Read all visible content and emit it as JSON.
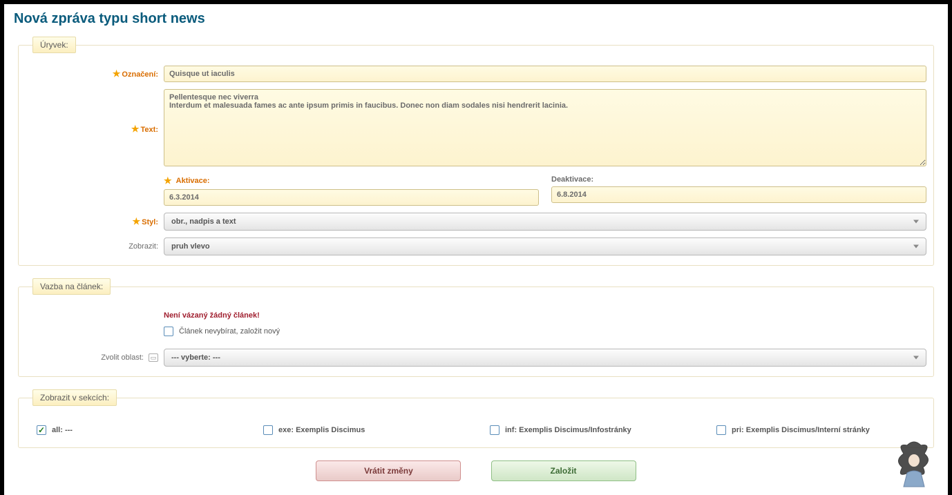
{
  "page": {
    "title": "Nová zpráva typu short news"
  },
  "fieldset1": {
    "legend": "Úryvek:"
  },
  "fieldset2": {
    "legend": "Vazba na článek:"
  },
  "fieldset3": {
    "legend": "Zobrazit v sekcích:"
  },
  "labels": {
    "oznaceni": "Označení:",
    "text": "Text:",
    "aktivace": "Aktivace:",
    "deaktivace": "Deaktivace:",
    "styl": "Styl:",
    "zobrazit": "Zobrazit:",
    "zvolit_oblast": "Zvolit oblast:"
  },
  "values": {
    "oznaceni": "Quisque ut iaculis",
    "text": "Pellentesque nec viverra\nInterdum et malesuada fames ac ante ipsum primis in faucibus. Donec non diam sodales nisi hendrerit lacinia.",
    "aktivace": "6.3.2014",
    "deaktivace": "6.8.2014"
  },
  "selects": {
    "styl": "obr., nadpis a text",
    "zobrazit": "pruh vlevo",
    "oblast": "--- vyberte: ---"
  },
  "article": {
    "warning": "Není vázaný žádný článek!",
    "checkbox_label": "Článek nevybírat, založit nový"
  },
  "sections": {
    "items": [
      {
        "label": "all: ---",
        "checked": true
      },
      {
        "label": "exe: Exemplis Discimus",
        "checked": false
      },
      {
        "label": "inf: Exemplis Discimus/Infostránky",
        "checked": false
      },
      {
        "label": "pri: Exemplis Discimus/Interní stránky",
        "checked": false
      }
    ]
  },
  "buttons": {
    "revert": "Vrátit změny",
    "save": "Založit"
  }
}
